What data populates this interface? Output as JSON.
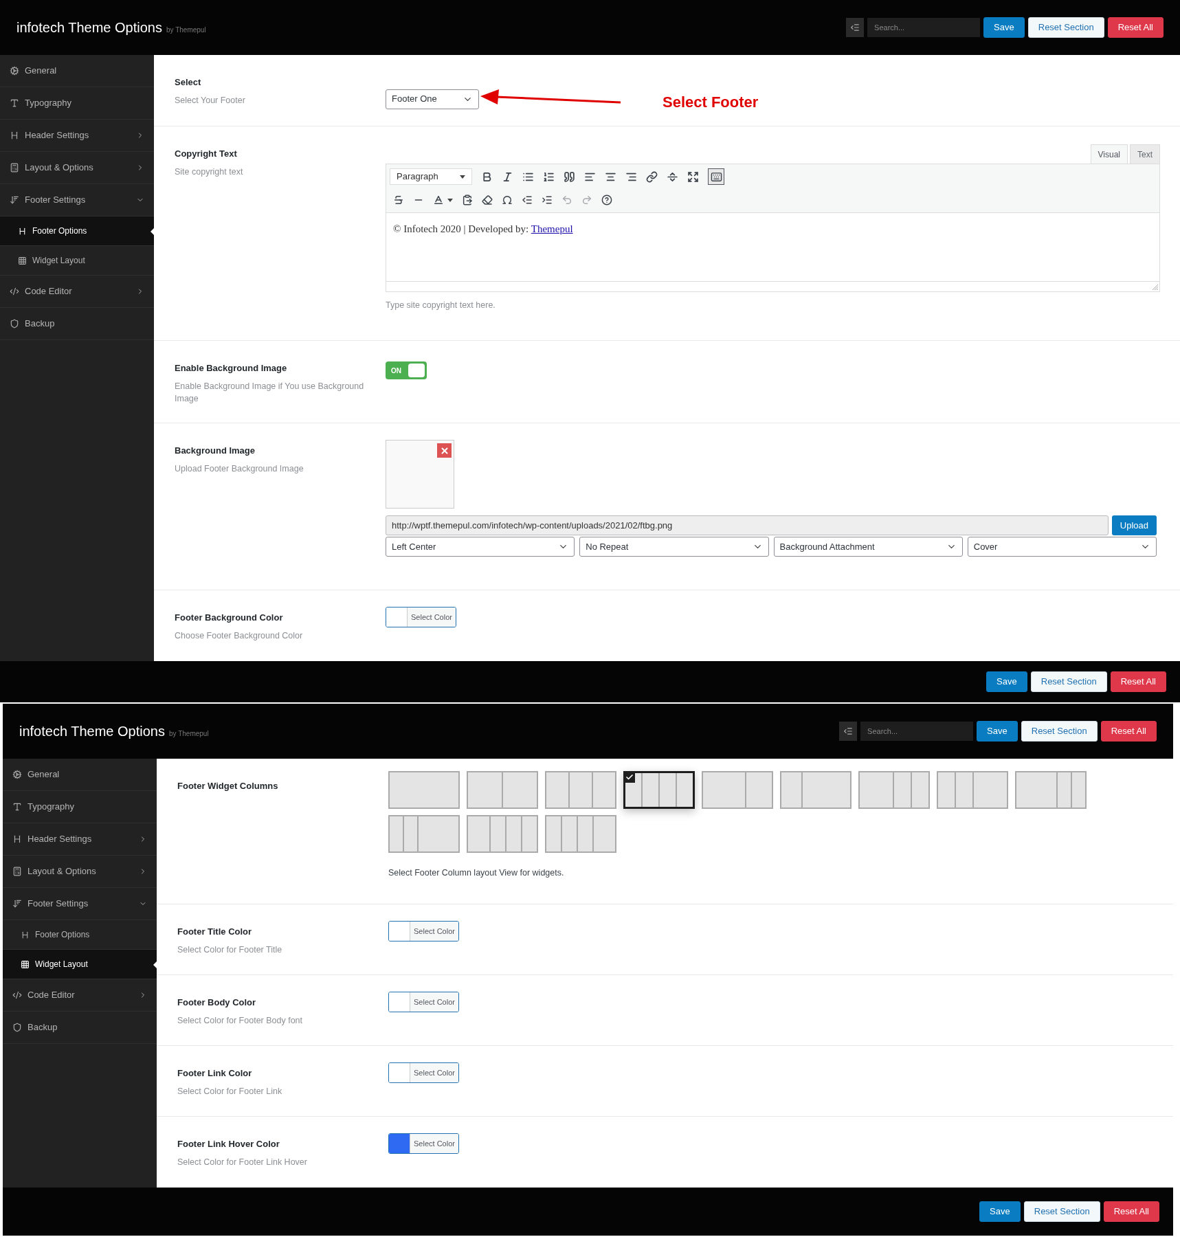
{
  "panels": [
    {
      "header": {
        "title": "infotech Theme Options",
        "byline": "by Themepul",
        "search": {
          "placeholder": "Search..."
        },
        "buttons": [
          {
            "label": "Save",
            "kind": "primary"
          },
          {
            "label": "Reset Section",
            "kind": "secondary"
          },
          {
            "label": "Reset All",
            "kind": "danger"
          }
        ]
      },
      "sidebar": {
        "items": [
          {
            "label": "General",
            "kind": "link"
          },
          {
            "label": "Typography",
            "kind": "link"
          },
          {
            "label": "Header Settings",
            "kind": "group",
            "expanded": false
          },
          {
            "label": "Layout & Options",
            "kind": "group",
            "expanded": false
          },
          {
            "label": "Footer Settings",
            "kind": "group",
            "expanded": true,
            "children": [
              {
                "label": "Footer Options",
                "selected": true
              },
              {
                "label": "Widget Layout",
                "selected": false
              }
            ]
          },
          {
            "label": "Code Editor",
            "kind": "group",
            "expanded": false
          },
          {
            "label": "Backup",
            "kind": "link"
          }
        ]
      },
      "fields": [
        {
          "kind": "select",
          "label": "Select",
          "description": "Select Your Footer",
          "value": "Footer One",
          "annotation": "Select Footer"
        },
        {
          "kind": "editor",
          "label": "Copyright Text",
          "description": "Site copyright text",
          "tabs": [
            {
              "label": "Visual",
              "selected": true
            },
            {
              "label": "Text",
              "selected": false
            }
          ],
          "format": "Paragraph",
          "content": "© Infotech 2020 | Developed by:",
          "link": "Themepul",
          "hint": "Type site copyright text here."
        },
        {
          "kind": "toggle",
          "label": "Enable Background Image",
          "description": "Enable Background Image if You use Background Image",
          "on": true,
          "state_label": "ON"
        },
        {
          "kind": "image",
          "label": "Background Image",
          "description": "Upload Footer Background Image",
          "url": "http://wptf.themepul.com/infotech/wp-content/uploads/2021/02/ftbg.png",
          "upload": "Upload",
          "selects": [
            "Left Center",
            "No Repeat",
            "Background Attachment",
            "Cover"
          ]
        },
        {
          "kind": "color",
          "label": "Footer Background Color",
          "description": "Choose Footer Background Color",
          "button": "Select Color",
          "color": "#ffffff"
        }
      ],
      "footer_buttons": [
        {
          "label": "Save",
          "kind": "primary"
        },
        {
          "label": "Reset Section",
          "kind": "secondary"
        },
        {
          "label": "Reset All",
          "kind": "danger"
        }
      ]
    },
    {
      "header": {
        "title": "infotech Theme Options",
        "byline": "by Themepul",
        "search": {
          "placeholder": "Search..."
        },
        "buttons": [
          {
            "label": "Save",
            "kind": "primary"
          },
          {
            "label": "Reset Section",
            "kind": "secondary"
          },
          {
            "label": "Reset All",
            "kind": "danger"
          }
        ]
      },
      "sidebar": {
        "items": [
          {
            "label": "General",
            "kind": "link"
          },
          {
            "label": "Typography",
            "kind": "link"
          },
          {
            "label": "Header Settings",
            "kind": "group",
            "expanded": false
          },
          {
            "label": "Layout & Options",
            "kind": "group",
            "expanded": false
          },
          {
            "label": "Footer Settings",
            "kind": "group",
            "expanded": true,
            "children": [
              {
                "label": "Footer Options",
                "selected": false
              },
              {
                "label": "Widget Layout",
                "selected": true
              }
            ]
          },
          {
            "label": "Code Editor",
            "kind": "group",
            "expanded": false
          },
          {
            "label": "Backup",
            "kind": "link"
          }
        ]
      },
      "fields": [
        {
          "kind": "layouts",
          "label": "Footer Widget Columns",
          "layouts": [
            {
              "kind": "full",
              "selected": false
            },
            {
              "kind": "halves",
              "selected": false
            },
            {
              "kind": "thirds",
              "selected": false
            },
            {
              "kind": "quarters",
              "selected": true
            },
            {
              "kind": "wideleft",
              "selected": false
            },
            {
              "kind": "wideright",
              "selected": false
            },
            {
              "kind": "halfleft",
              "selected": false
            },
            {
              "kind": "halfright",
              "selected": false
            },
            {
              "kind": "bigleft",
              "selected": false
            },
            {
              "kind": "bigright",
              "selected": false
            },
            {
              "kind": "leadfour",
              "selected": false
            },
            {
              "kind": "trailfour",
              "selected": false
            }
          ],
          "hint": "Select Footer Column layout View for widgets."
        },
        {
          "kind": "color",
          "label": "Footer Title Color",
          "description": "Select Color for Footer Title",
          "button": "Select Color",
          "color": "#ffffff"
        },
        {
          "kind": "color",
          "label": "Footer Body Color",
          "description": "Select Color for Footer Body font",
          "button": "Select Color",
          "color": "#ffffff"
        },
        {
          "kind": "color",
          "label": "Footer Link Color",
          "description": "Select Color for Footer Link",
          "button": "Select Color",
          "color": "#ffffff"
        },
        {
          "kind": "color",
          "label": "Footer Link Hover Color",
          "description": "Select Color for Footer Link Hover",
          "button": "Select Color",
          "color": "#2f6af2"
        }
      ],
      "footer_buttons": [
        {
          "label": "Save",
          "kind": "primary"
        },
        {
          "label": "Reset Section",
          "kind": "secondary"
        },
        {
          "label": "Reset All",
          "kind": "danger"
        }
      ]
    }
  ]
}
